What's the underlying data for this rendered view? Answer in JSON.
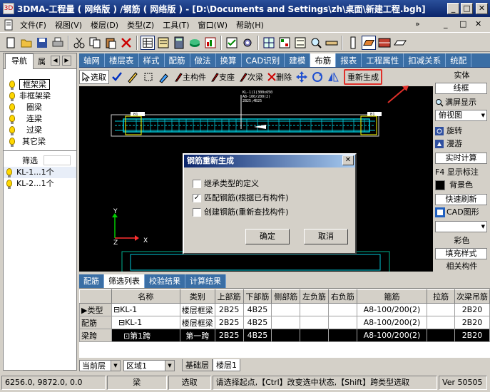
{
  "window": {
    "title": "3DMA-工程量 ( 网络版 ) /钢筋 ( 网络版 ) - [D:\\Documents and Settings\\zh\\桌面\\新建工程.bgh]",
    "app_icon_text": "3D",
    "min_glyph": "_",
    "max_glyph": "□",
    "close_glyph": "✕"
  },
  "menu": {
    "items": [
      "文件(F)",
      "视图(V)",
      "楼层(D)",
      "类型(Z)",
      "工具(T)",
      "窗口(W)",
      "帮助(H)"
    ],
    "overflow": "»",
    "mdi_min": "_",
    "mdi_max": "□",
    "mdi_close": "✕"
  },
  "left_panel": {
    "tab_nav": "导航",
    "tab_props": "属",
    "close_glyph": "✕",
    "tree": [
      "框架梁",
      "非框架梁",
      "圈梁",
      "连梁",
      "过梁",
      "其它梁"
    ],
    "filter_label": "筛选",
    "filter_value": "",
    "results": [
      "KL-1...1个",
      "KL-2...1个"
    ]
  },
  "tabs": [
    "轴网",
    "楼层表",
    "样式",
    "配筋",
    "做法",
    "换算",
    "CAD识别",
    "建模",
    "布筋",
    "报表",
    "工程属性",
    "扣减关系",
    "统配"
  ],
  "active_tab": "布筋",
  "toolbar2": {
    "select": "选取",
    "main_member": "主构件",
    "support": "支座",
    "secondary_beam": "次梁",
    "delete": "删除",
    "regenerate": "重新生成"
  },
  "canvas_text": {
    "note_line1": "KL-1(1)300x650",
    "note_line2": "A8-100/200(2)",
    "note_line3": "2B25;4B25",
    "axis_y": "Y",
    "axis_x": "X",
    "axis_z": "Z",
    "tag": "B1"
  },
  "right_panel": {
    "entity": "实体",
    "wireframe": "线框",
    "fullscreen": "满屏显示",
    "view_select": "俯视图",
    "rotate": "旋转",
    "roam": "漫游",
    "realtime_calc": "实时计算",
    "show_notes": "F4 显示标注",
    "background": "背景色",
    "quick_refresh": "快速刷新",
    "cad_graph": "CAD图形",
    "color": "彩色",
    "fill_style": "填充样式",
    "related": "相关构件"
  },
  "dialog": {
    "title": "钢筋重新生成",
    "close": "✕",
    "opt1": "继承类型的定义",
    "opt2": "匹配钢筋(根据已有构件)",
    "opt3": "创建钢筋(重新查找构件)",
    "opt1_checked": false,
    "opt2_checked": true,
    "opt3_checked": false,
    "ok": "确定",
    "cancel": "取消"
  },
  "bottom_tabs": [
    "配筋",
    "筛选列表",
    "校验结果",
    "计算结果"
  ],
  "bottom_active": "筛选列表",
  "table": {
    "headers": [
      "",
      "名称",
      "类别",
      "上部筋",
      "下部筋",
      "侧部筋",
      "左负筋",
      "右负筋",
      "箍筋",
      "拉筋",
      "次梁吊筋"
    ],
    "rows": [
      {
        "marker": "▶",
        "col0": "类型",
        "name": "⊟KL-1",
        "cat": "楼层框梁",
        "top": "2B25",
        "bot": "4B25",
        "side": "",
        "left": "",
        "right": "",
        "stir": "A8-100/200(2)",
        "tie": "",
        "hang": "2B20"
      },
      {
        "marker": "",
        "col0": "配筋",
        "name": "  ⊟KL-1",
        "cat": "楼层框梁",
        "top": "2B25",
        "bot": "4B25",
        "side": "",
        "left": "",
        "right": "",
        "stir": "A8-100/200(2)",
        "tie": "",
        "hang": "2B20"
      },
      {
        "marker": "",
        "col0": "梁跨",
        "name": "    ⊡第1跨",
        "cat": "第一跨",
        "top": "2B25",
        "bot": "4B25",
        "side": "",
        "left": "",
        "right": "",
        "stir": "A8-100/200(2)",
        "tie": "",
        "hang": "2B20"
      }
    ]
  },
  "floorbar": {
    "current_floor_label": "当前层",
    "area_value": "区域1",
    "floor_tabs": [
      "基础层",
      "楼层1"
    ]
  },
  "status": {
    "coords": "6256.0, 9872.0, 0.0",
    "member": "梁",
    "mode": "选取",
    "hint": "请选择起点,【Ctrl】改变选中状态,【Shift】跨类型选取",
    "version": "Ver 50505"
  },
  "colors": {
    "title_dark": "#0a246a",
    "tab_blue": "#3a6ea5",
    "highlight_red": "#e0302a",
    "canvas_bg": "#000000",
    "rebar_cyan": "#00c8d8"
  }
}
